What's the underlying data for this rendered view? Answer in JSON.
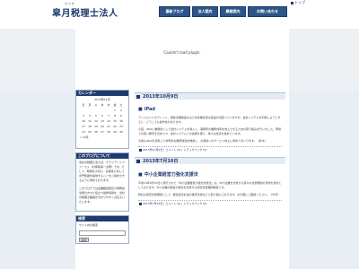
{
  "header": {
    "logo_small": "るつき",
    "logo": "皐月税理士法人",
    "top_link": "トップ",
    "nav": [
      "最新ブログ",
      "法人案内",
      "業務案内",
      "お問い合わせ"
    ]
  },
  "plugin_message": "Couldn't load plugin.",
  "sidebar": {
    "calendar": {
      "heading": "カレンダー",
      "month": "2013年11月",
      "weekdays": [
        "日",
        "月",
        "火",
        "水",
        "木",
        "金",
        "土"
      ],
      "weeks": [
        [
          "",
          "",
          "",
          "",
          "",
          "1",
          "2"
        ],
        [
          "3",
          "4",
          "5",
          "6",
          "7",
          "8",
          "9"
        ],
        [
          "10",
          "11",
          "12",
          "13",
          "14",
          "15",
          "16"
        ],
        [
          "17",
          "18",
          "19",
          "20",
          "21",
          "22",
          "23"
        ],
        [
          "24",
          "25",
          "26",
          "27",
          "28",
          "29",
          "30"
        ]
      ],
      "prev": "« 10月"
    },
    "blog": {
      "heading": "このブログについて",
      "para1": "当社の税理士法人は、クライアントファースト（お客様第一主義）です。そして、時間を大切に、お客様に対して専門知識を提供することをご案内できるように努めております。",
      "para2": "このブログでは企業経営者及び財務担当者の方々に役立つ最新情報を、当社の税理士職員が分かりやすくお伝えいたします。"
    },
    "search": {
      "heading": "検索",
      "label": "サイト内の検索",
      "button": "検索"
    }
  },
  "posts": [
    {
      "date": "2013年10月9日",
      "title": "iPad",
      "paras": [
        "アンドロイドタブレット、国産企業製品をはじめ多種多様な製品が出回っていますが、会計システムを利用しようとすると、どうしても操作性が劣ります。",
        "今回、iPadに業務用として会計システムを導入し、事務所の業務効率を向上させるための取り組みを行いました。現場での使い勝手を高めつつ、会計システムとの連携を図り、様々な改善を進めています。",
        "今後もiPadを活用した効率的な業務運営を推進し、お客様へのサービス向上に努めてまいります。（鈴木）"
      ],
      "footer": "2013年10月9日 | コメント (0) | トラックバック (0)"
    },
    {
      "date": "2013年7月16日",
      "title": "中小企業経営力強化支援法",
      "paras": [
        "平成24年8月30日に施行された「中小企業経営力強化支援法」は、中小企業を支援する様々な支援機関の育成を目的としております。中小企業の経営力強化を支援する認定支援機関制度です。",
        "弊社も認定支援機関として、経営改善計画の策定支援などに取り組んでおります。お気軽にご相談ください。（皐月）"
      ],
      "footer": "2013年7月16日 | コメント (0) | トラックバック (0)"
    }
  ]
}
